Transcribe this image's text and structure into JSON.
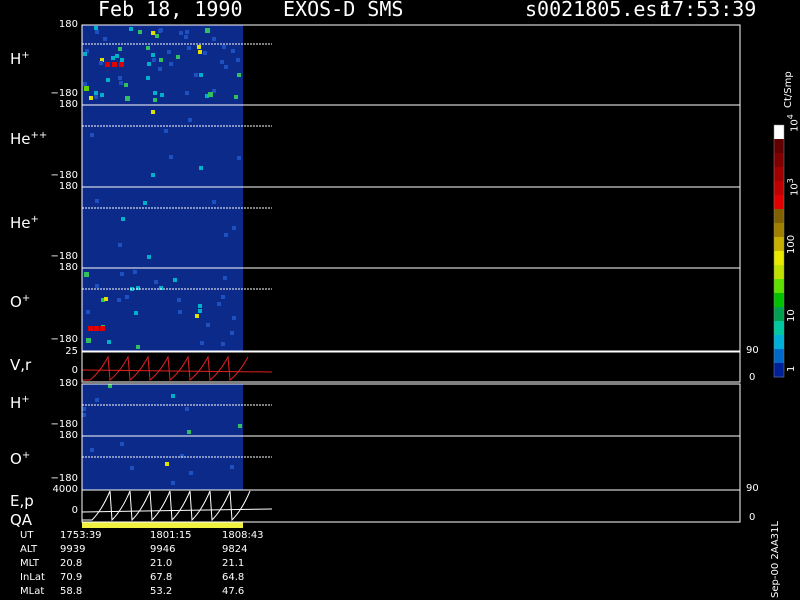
{
  "header": {
    "date": "Feb 18, 1990",
    "instrument": "EXOS-D SMS",
    "file": "s0021805.esr",
    "time": "17:53:39"
  },
  "panels": [
    {
      "id": "h-plus-pitch",
      "label": "H",
      "sup": "+",
      "ytop": "180",
      "ybot": "−180"
    },
    {
      "id": "he-plus-plus",
      "label": "He",
      "sup": "++",
      "ytop": "180",
      "ybot": "−180"
    },
    {
      "id": "he-plus",
      "label": "He",
      "sup": "+",
      "ytop": "180",
      "ybot": "−180"
    },
    {
      "id": "o-plus-pitch",
      "label": "O",
      "sup": "+",
      "ytop": "180",
      "ybot": "−180"
    },
    {
      "id": "v-r",
      "label": "V,r",
      "sup": "",
      "ytop": "25",
      "ybot": "0",
      "rtop": "90",
      "rbot": "0"
    },
    {
      "id": "h-plus-2",
      "label": "H",
      "sup": "+",
      "ytop": "180",
      "ybot": "−180"
    },
    {
      "id": "o-plus-2",
      "label": "O",
      "sup": "+",
      "ytop": "180",
      "ybot": "−180"
    },
    {
      "id": "e-p",
      "label": "E,p",
      "sup": "",
      "ytop": "4000",
      "ybot": "0",
      "rtop": "90",
      "rbot": "0"
    }
  ],
  "qa_label": "QA",
  "colorbar": {
    "unit": "Ct/Smp",
    "ticks": [
      "1",
      "10",
      "100",
      "10",
      "10"
    ],
    "tick_exps": [
      "",
      "",
      "",
      "3",
      "4"
    ],
    "colors": [
      "#00209a",
      "#0068c8",
      "#00b0d8",
      "#00c8a0",
      "#00a050",
      "#00c000",
      "#60e000",
      "#c0e000",
      "#e8e800",
      "#c8b000",
      "#a08000",
      "#806000",
      "#e00000",
      "#c00000",
      "#a00000",
      "#800000",
      "#600000",
      "#ffffff"
    ]
  },
  "footer": {
    "rows": [
      {
        "name": "UT",
        "values": [
          "1753:39",
          "1801:15",
          "1808:43"
        ]
      },
      {
        "name": "ALT",
        "values": [
          "9939",
          "9946",
          "9824"
        ]
      },
      {
        "name": "MLT",
        "values": [
          "20.8",
          "21.0",
          "21.1"
        ]
      },
      {
        "name": "InLat",
        "values": [
          "70.9",
          "67.8",
          "64.8"
        ]
      },
      {
        "name": "MLat",
        "values": [
          "58.8",
          "53.2",
          "47.6"
        ]
      }
    ],
    "side_note": "Sep-00 2AA31L"
  },
  "chart_data": {
    "type": "heatmap",
    "title": "",
    "time_labels": [
      "1753:39",
      "1801:15",
      "1808:43"
    ],
    "panels": [
      "H+",
      "He++",
      "He+",
      "O+",
      "V,r",
      "H+",
      "O+",
      "E,p"
    ],
    "pitch_range": [
      -180,
      180
    ],
    "v_range": [
      0,
      25
    ],
    "e_range": [
      0,
      4000
    ],
    "colorbar_range": [
      "1",
      "10^4"
    ],
    "colorbar_scale": "log",
    "data_coverage_fraction": 0.085
  }
}
